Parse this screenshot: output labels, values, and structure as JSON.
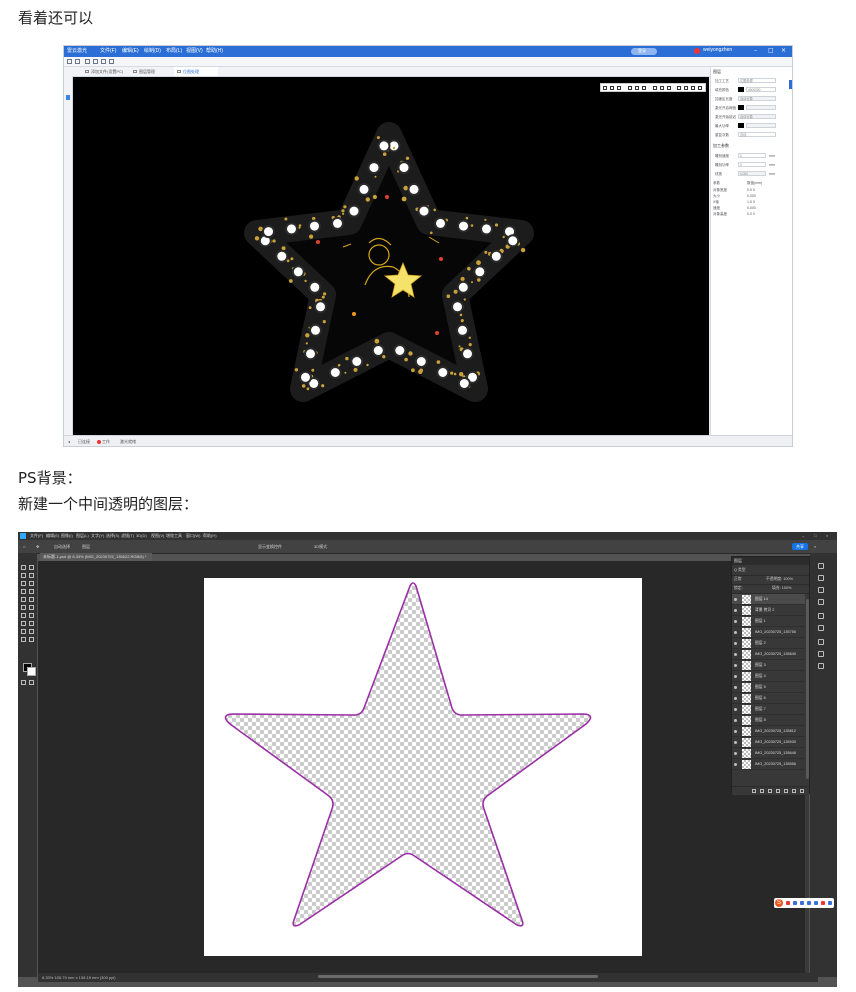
{
  "captions": {
    "intro": "看着还可以",
    "ps_bg": "PS背景：",
    "new_layer": "新建一个中间透明的图层："
  },
  "app1": {
    "title_items": [
      "雷云激光",
      "文件(F)",
      "编辑(E)",
      "绘制(D)",
      "布局(L)",
      "视图(V)",
      "帮助(H)",
      "更多设置"
    ],
    "account_badge": "登录",
    "user_name": "weiyongzhen",
    "tabs": [
      "添加文件(设置PC)",
      "图层管理",
      "位图处理"
    ],
    "right_panel": {
      "section1": "图层",
      "rows": [
        {
          "label": "加工工艺",
          "value": "位图处理"
        },
        {
          "label": "填充颜色",
          "value": "#000000"
        },
        {
          "label": "加速区长度",
          "value": "自动计算"
        },
        {
          "label": "激光开启阈值",
          "value": ""
        },
        {
          "label": "激光开始延迟",
          "value": "自动计算"
        },
        {
          "label": "最大功率",
          "value": ""
        },
        {
          "label": "重复次数",
          "value": "自动"
        }
      ],
      "section2": "加工参数",
      "params": [
        {
          "label": "雕刻速度",
          "value": "0",
          "unit": "mm"
        },
        {
          "label": "雕刻功率",
          "value": "0",
          "unit": "mm"
        },
        {
          "label": "线宽",
          "value": "0.000",
          "unit": "mm"
        }
      ],
      "table_header": [
        "参数",
        "数值(mm)"
      ],
      "table": [
        [
          "对象宽度",
          "0.0 0"
        ],
        [
          "大小",
          "0.000"
        ],
        [
          "X轴",
          "1.5 0"
        ],
        [
          "速度",
          "0.000"
        ],
        [
          "对象高度",
          "0.0 0"
        ]
      ]
    },
    "status": [
      "已连接",
      "工作",
      "激光就绪"
    ]
  },
  "app2": {
    "menu": [
      "文件(F)",
      "编辑(E)",
      "图像(I)",
      "图层(L)",
      "文字(Y)",
      "选择(S)",
      "滤镜(T)",
      "3D(D)",
      "视图(V)",
      "增效工具",
      "窗口(W)",
      "帮助(H)"
    ],
    "options": [
      "自动选择",
      "图层",
      "显示变换控件",
      "3D模式"
    ],
    "share_label": "共享",
    "doc_tab": "未标题-1.psd @ 8.33% (IMG_20230725_135622,RGB/8) *",
    "layers_title": "图层",
    "layer_kind": "Q 类型",
    "blend_mode": "正常",
    "opacity_label": "不透明度: 100%",
    "lock_label": "锁定:",
    "fill_label": "填充: 100%",
    "layers": [
      "图层 14",
      "背景 拷贝 2",
      "图层 1",
      "IMG_20230725_135756",
      "图层 2",
      "IMG_20230725_135640",
      "图层 3",
      "图层 4",
      "图层 5",
      "图层 6",
      "图层 7",
      "图层 8",
      "IMG_20230725_135812",
      "IMG_20230725_135930",
      "IMG_20230725_135646",
      "IMG_20230725_135556"
    ],
    "status": "8.33%   105.79 mm x 135.19 mm (300 ppi)"
  }
}
